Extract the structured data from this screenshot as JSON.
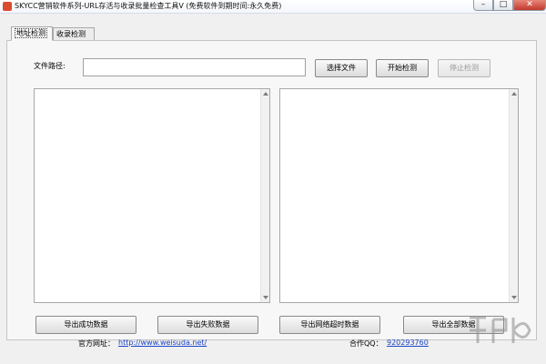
{
  "window": {
    "title": "SKYCC营销软件系列-URL存活与收录批量检查工具V (免费软件到期时间:永久免费)",
    "controls": {
      "minimize": "–",
      "maximize": "□",
      "close": "✕"
    }
  },
  "tabs": [
    {
      "label": "地址检测",
      "active": true
    },
    {
      "label": "收录检测",
      "active": false
    }
  ],
  "file_path": {
    "label": "文件路径:",
    "value": "",
    "placeholder": ""
  },
  "buttons": {
    "select_file": "选择文件",
    "start_check": "开始检测",
    "stop_check": "停止检测",
    "export_success": "导出成功数据",
    "export_fail": "导出失败数据",
    "export_timeout": "导出网络超时数据",
    "export_all": "导出全部数据"
  },
  "footer": {
    "website_label": "官方网址：",
    "website_url": "http://www.weisuda.net/",
    "qq_label": "合作QQ：",
    "qq_number": "920293760"
  },
  "colors": {
    "link": "#1a44c8",
    "window_bg": "#f0f0f0",
    "close_button": "#c1392b"
  }
}
